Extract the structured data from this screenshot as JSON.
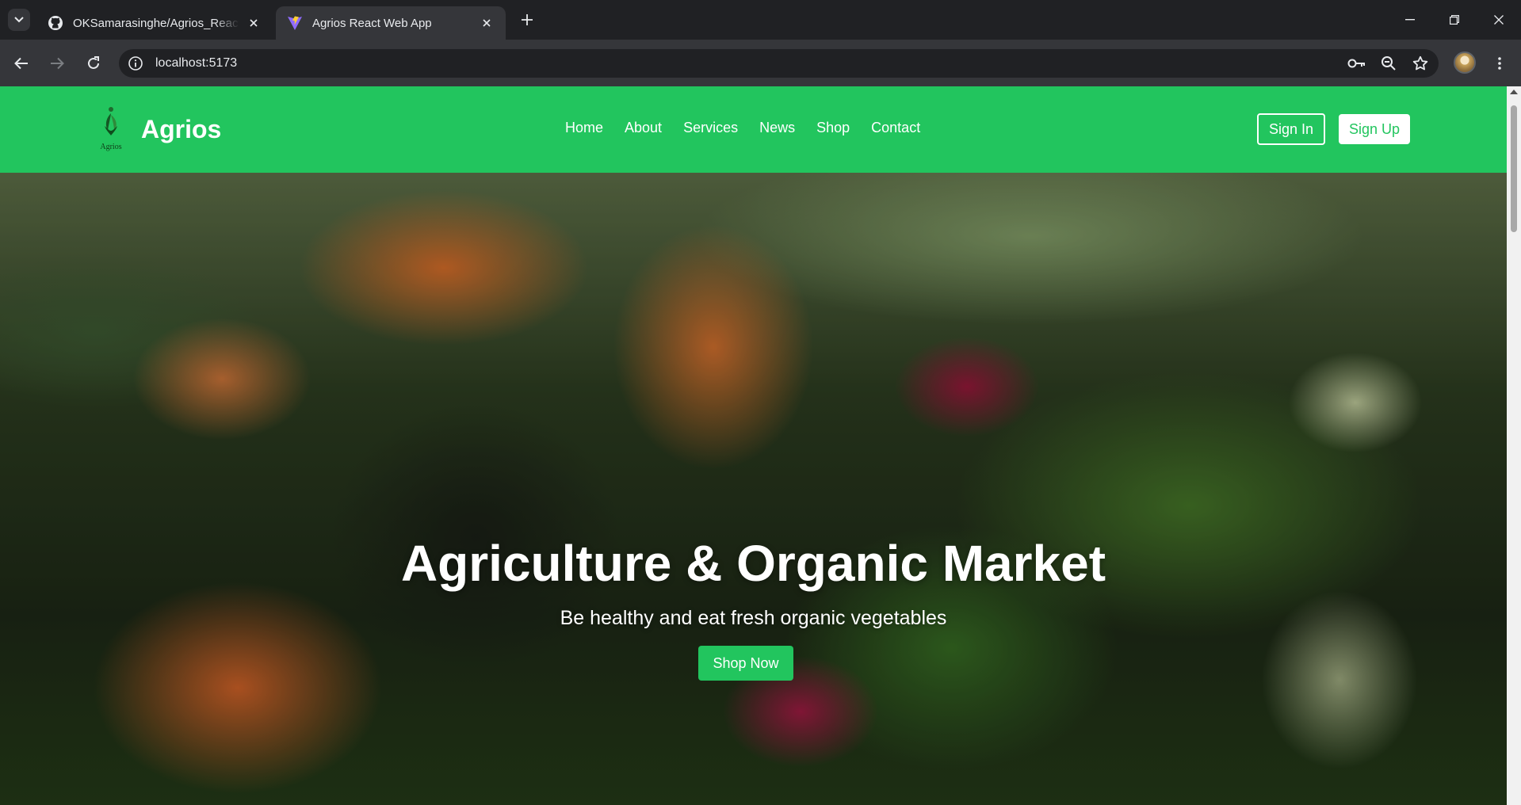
{
  "browser": {
    "tabs": [
      {
        "title": "OKSamarasinghe/Agrios_React_",
        "icon": "github-icon",
        "active": false
      },
      {
        "title": "Agrios React Web App",
        "icon": "vite-icon",
        "active": true
      }
    ],
    "url": "localhost:5173"
  },
  "site": {
    "brand": {
      "name": "Agrios",
      "logo_text": "Agrios"
    },
    "nav": [
      "Home",
      "About",
      "Services",
      "News",
      "Shop",
      "Contact"
    ],
    "auth": {
      "signin": "Sign In",
      "signup": "Sign Up"
    }
  },
  "hero": {
    "title": "Agriculture & Organic Market",
    "subtitle": "Be healthy and eat fresh organic vegetables",
    "cta": "Shop Now"
  },
  "colors": {
    "brand_green": "#22c55e",
    "chrome_dark": "#202124",
    "chrome_toolbar": "#35363a"
  }
}
